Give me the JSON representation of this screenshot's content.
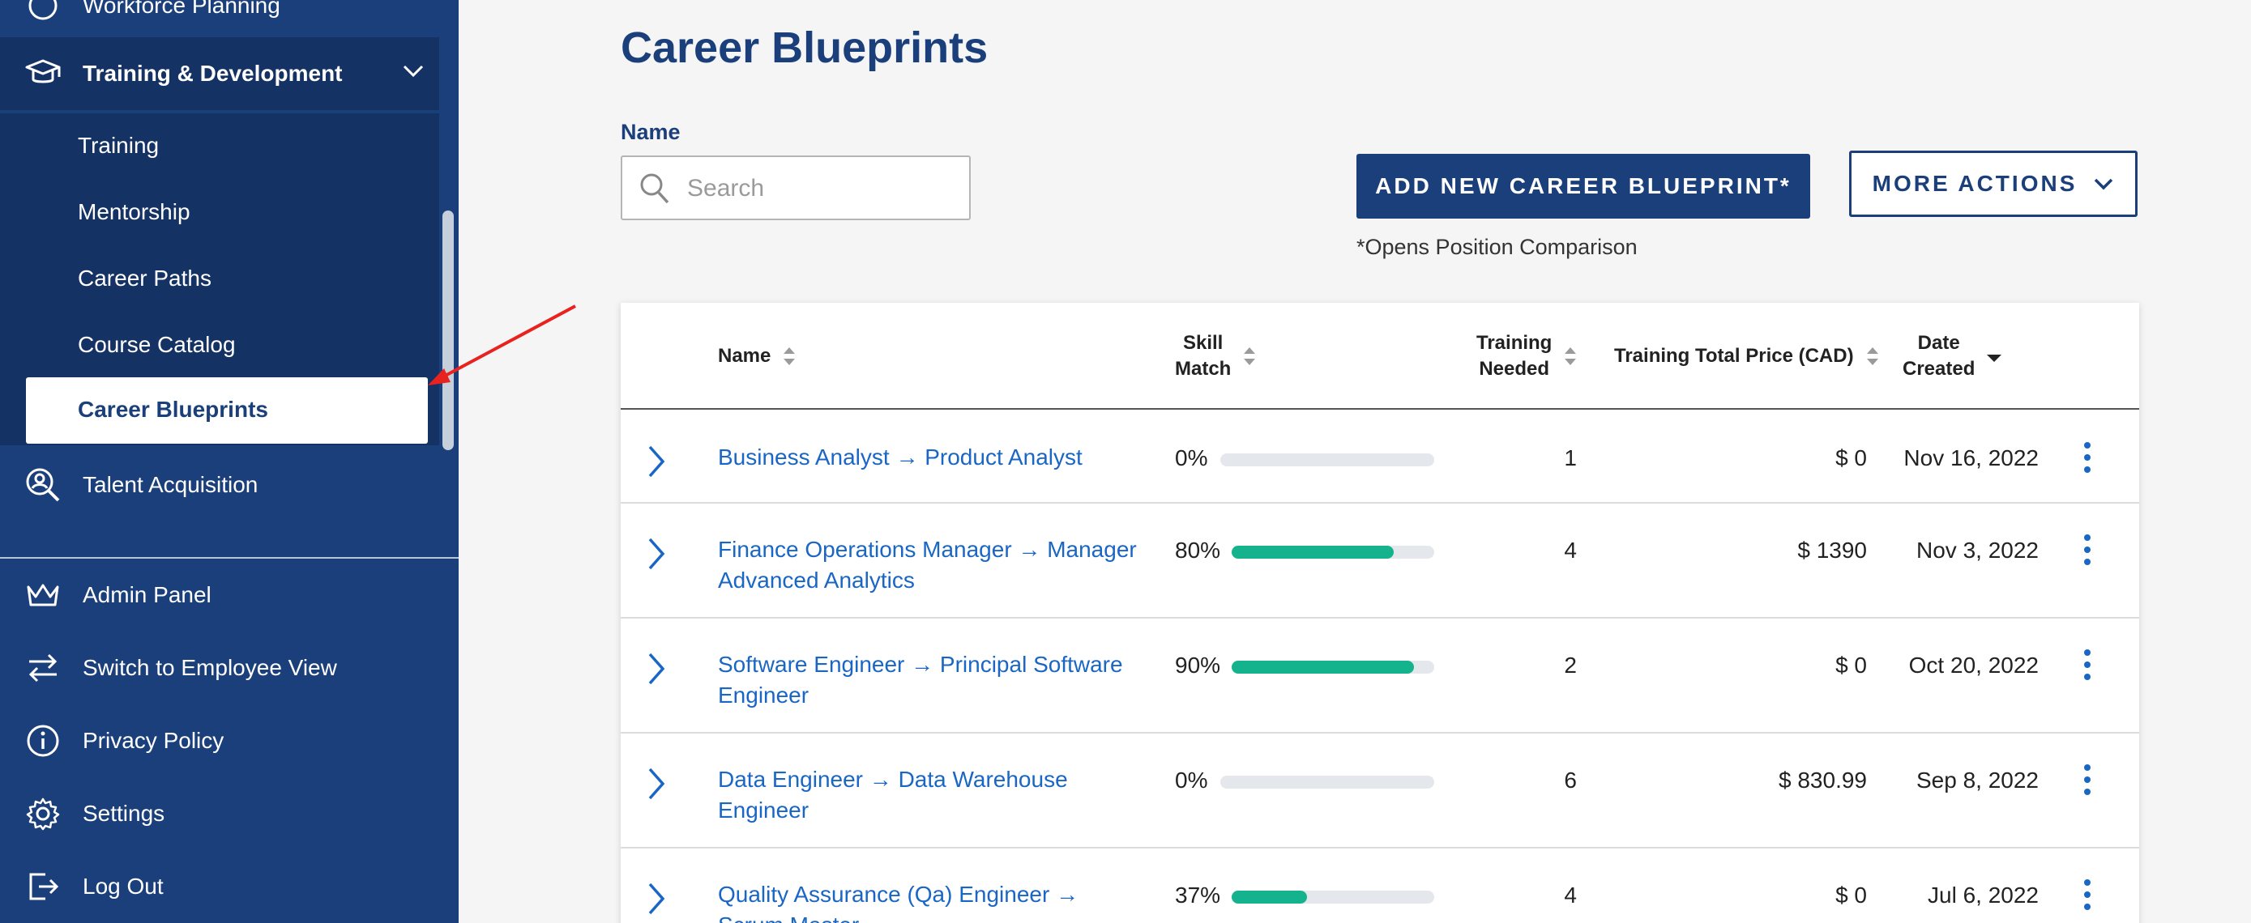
{
  "sidebar": {
    "top_partial": "Workforce Planning",
    "section": "Training & Development",
    "subitems": [
      "Training",
      "Mentorship",
      "Career Paths",
      "Course Catalog"
    ],
    "active": "Career Blueprints",
    "talent": "Talent Acquisition",
    "bottom": {
      "admin": "Admin Panel",
      "switch": "Switch to Employee View",
      "privacy": "Privacy Policy",
      "settings": "Settings",
      "logout": "Log Out"
    }
  },
  "page": {
    "title": "Career Blueprints",
    "name_label": "Name",
    "search_placeholder": "Search",
    "add_button": "ADD NEW CAREER BLUEPRINT*",
    "more_button": "MORE ACTIONS",
    "note": "*Opens Position Comparison"
  },
  "table": {
    "headers": {
      "name": "Name",
      "skill": [
        "Skill",
        "Match"
      ],
      "training": [
        "Training",
        "Needed"
      ],
      "price": "Training Total Price (CAD)",
      "date": [
        "Date",
        "Created"
      ]
    },
    "rows": [
      {
        "name": "Business Analyst → Product Analyst",
        "skill": "0%",
        "skill_value": 0,
        "training": "1",
        "price": "$ 0",
        "date": "Nov 16, 2022"
      },
      {
        "name": "Finance Operations Manager → Manager Advanced Analytics",
        "skill": "80%",
        "skill_value": 80,
        "training": "4",
        "price": "$ 1390",
        "date": "Nov 3, 2022"
      },
      {
        "name": "Software Engineer → Principal Software Engineer",
        "skill": "90%",
        "skill_value": 90,
        "training": "2",
        "price": "$ 0",
        "date": "Oct 20, 2022"
      },
      {
        "name": "Data Engineer → Data Warehouse Engineer",
        "skill": "0%",
        "skill_value": 0,
        "training": "6",
        "price": "$ 830.99",
        "date": "Sep 8, 2022"
      },
      {
        "name": "Quality Assurance (Qa) Engineer → Scrum Master",
        "skill": "37%",
        "skill_value": 37,
        "training": "4",
        "price": "$ 0",
        "date": "Jul 6, 2022"
      }
    ]
  },
  "colors": {
    "sidebar": "#1a3f7a",
    "accent": "#1a3f7a",
    "link": "#1a66c4",
    "progress": "#15b38d",
    "annotation_arrow": "#e8231f"
  }
}
